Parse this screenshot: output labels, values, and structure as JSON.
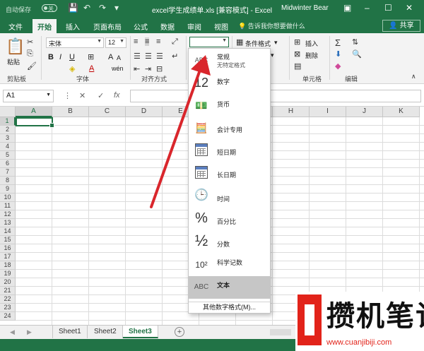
{
  "titlebar": {
    "autosave_label": "自动保存",
    "toggle_state": "关",
    "doc_title": "excel学生成绩单.xls  [兼容模式]  -  Excel",
    "user_name": "Midwinter Bear"
  },
  "tabs": [
    "文件",
    "开始",
    "插入",
    "页面布局",
    "公式",
    "数据",
    "审阅",
    "视图"
  ],
  "active_tab": "开始",
  "tell_me": "告诉我你想要做什么",
  "share_label": "共享",
  "ribbon": {
    "clipboard": {
      "paste_label": "粘贴",
      "group_label": "剪贴板"
    },
    "font": {
      "font_name": "宋体",
      "font_size": "12",
      "group_label": "字体"
    },
    "alignment": {
      "group_label": "对齐方式"
    },
    "number": {
      "format_value": ""
    },
    "styles": {
      "conditional_label": "条件格式"
    },
    "cells": {
      "insert_label": "插入",
      "delete_label": "删除",
      "group_label": "单元格"
    },
    "editing": {
      "group_label": "编辑"
    }
  },
  "formula_bar": {
    "name_box": "A1",
    "fx_label": "fx",
    "formula": ""
  },
  "grid": {
    "columns": [
      "A",
      "B",
      "C",
      "D",
      "E",
      "F",
      "G",
      "H",
      "I",
      "J",
      "K"
    ],
    "rows": [
      "1",
      "2",
      "3",
      "4",
      "5",
      "6",
      "7",
      "8",
      "9",
      "10",
      "11",
      "12",
      "13",
      "14",
      "15",
      "16",
      "17",
      "18",
      "19",
      "20",
      "21",
      "22",
      "23",
      "24"
    ],
    "selected_cell": "A1"
  },
  "number_format_menu": {
    "items": [
      {
        "icon": "general-format-icon",
        "icon_text": "ABC",
        "label": "常规",
        "sub": "无特定格式"
      },
      {
        "icon": "number-format-icon",
        "icon_text": "12",
        "label": "数字",
        "sub": ""
      },
      {
        "icon": "currency-format-icon",
        "icon_text": "",
        "label": "货币",
        "sub": ""
      },
      {
        "icon": "accounting-format-icon",
        "icon_text": "",
        "label": "会计专用",
        "sub": ""
      },
      {
        "icon": "short-date-icon",
        "icon_text": "",
        "label": "短日期",
        "sub": ""
      },
      {
        "icon": "long-date-icon",
        "icon_text": "",
        "label": "长日期",
        "sub": ""
      },
      {
        "icon": "time-format-icon",
        "icon_text": "",
        "label": "时间",
        "sub": ""
      },
      {
        "icon": "percentage-icon",
        "icon_text": "%",
        "label": "百分比",
        "sub": ""
      },
      {
        "icon": "fraction-icon",
        "icon_text": "½",
        "label": "分数",
        "sub": ""
      },
      {
        "icon": "scientific-icon",
        "icon_text": "10²",
        "label": "科学记数",
        "sub": ""
      },
      {
        "icon": "text-format-icon",
        "icon_text": "ABC",
        "label": "文本",
        "sub": ""
      }
    ],
    "highlighted": "文本",
    "more_label": "其他数字格式(M)..."
  },
  "sheets": [
    "Sheet1",
    "Sheet2",
    "Sheet3"
  ],
  "active_sheet": "Sheet3",
  "watermark": {
    "title": "攒机笔记",
    "url": "www.cuanjibiji.com"
  },
  "colors": {
    "brand_green": "#217346",
    "arrow_red": "#d9262c",
    "watermark_red": "#e2231a"
  }
}
